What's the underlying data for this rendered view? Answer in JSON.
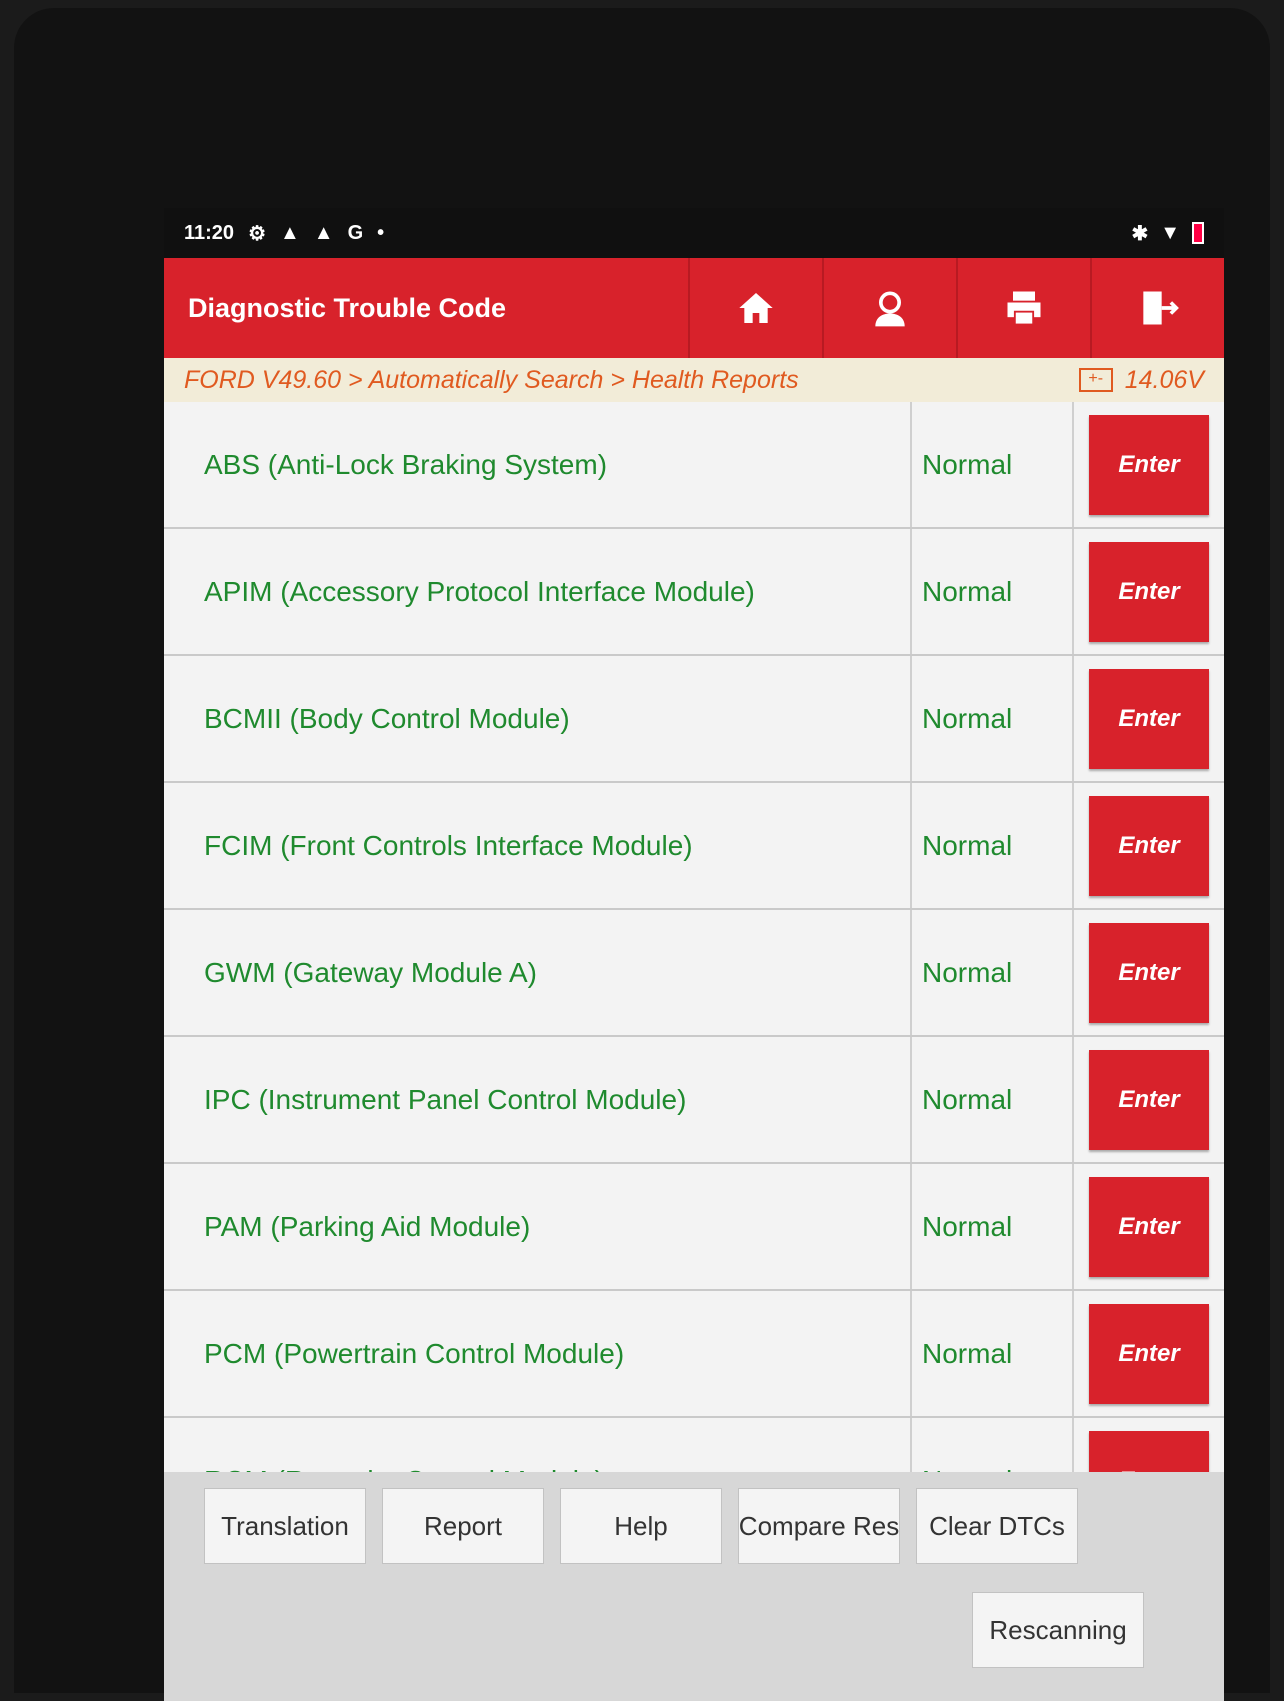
{
  "status_bar": {
    "time": "11:20",
    "icons_left": [
      "settings-icon",
      "warning-icon",
      "warning-icon",
      "google-icon",
      "dot-icon"
    ],
    "icons_right": [
      "bluetooth-icon",
      "wifi-icon",
      "battery-icon"
    ]
  },
  "header": {
    "title": "Diagnostic Trouble Code",
    "buttons": [
      "home-icon",
      "support-icon",
      "print-icon",
      "exit-icon"
    ]
  },
  "breadcrumb": {
    "path": "FORD V49.60 > Automatically Search > Health Reports",
    "voltage": "14.06V",
    "battery_glyph": "+-"
  },
  "modules": [
    {
      "name": "ABS (Anti-Lock Braking System)",
      "status": "Normal",
      "action": "Enter"
    },
    {
      "name": "APIM (Accessory Protocol Interface Module)",
      "status": "Normal",
      "action": "Enter"
    },
    {
      "name": "BCMII (Body Control Module)",
      "status": "Normal",
      "action": "Enter"
    },
    {
      "name": "FCIM (Front Controls Interface Module)",
      "status": "Normal",
      "action": "Enter"
    },
    {
      "name": "GWM (Gateway Module A)",
      "status": "Normal",
      "action": "Enter"
    },
    {
      "name": "IPC (Instrument Panel Control Module)",
      "status": "Normal",
      "action": "Enter"
    },
    {
      "name": "PAM (Parking Aid Module)",
      "status": "Normal",
      "action": "Enter"
    },
    {
      "name": "PCM (Powertrain Control Module)",
      "status": "Normal",
      "action": "Enter"
    },
    {
      "name": "RCM (Restraint Control Module)",
      "status": "Normal",
      "action": "Enter"
    }
  ],
  "footer": {
    "buttons": [
      "Translation",
      "Report",
      "Help",
      "Compare Res",
      "Clear DTCs"
    ],
    "rescan": "Rescanning"
  },
  "colors": {
    "accent": "#d8222b",
    "status_text": "#1f8a2e",
    "breadcrumb_text": "#e05a20"
  }
}
